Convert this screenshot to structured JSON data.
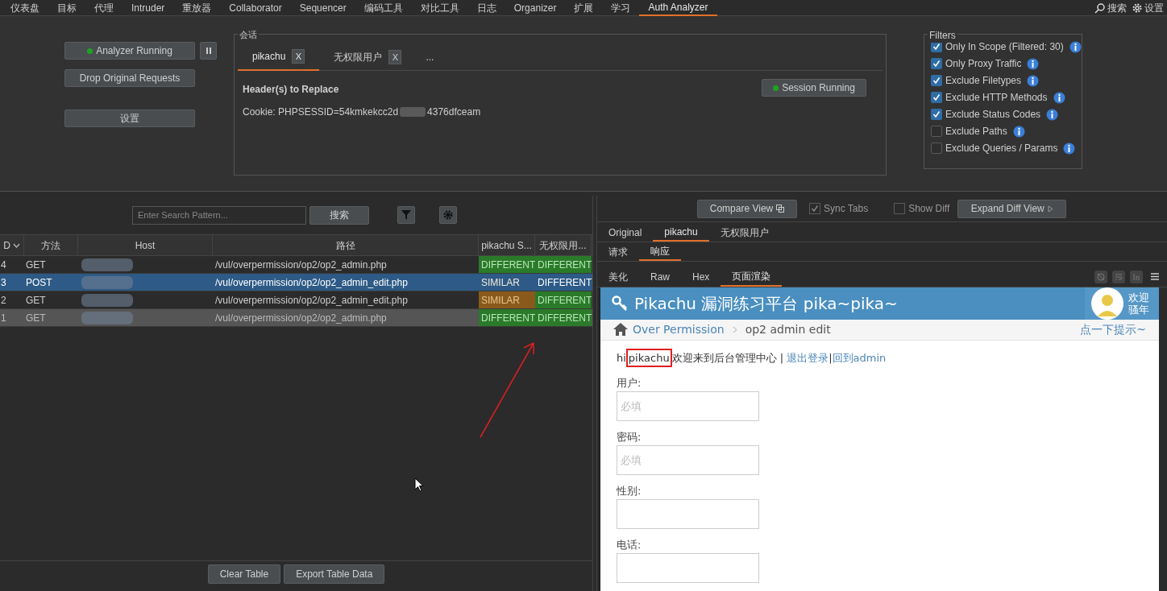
{
  "menu_tabs": [
    {
      "label": "仪表盘",
      "selected": false
    },
    {
      "label": "目标",
      "selected": false
    },
    {
      "label": "代理",
      "selected": false
    },
    {
      "label": "Intruder",
      "selected": false
    },
    {
      "label": "重放器",
      "selected": false
    },
    {
      "label": "Collaborator",
      "selected": false
    },
    {
      "label": "Sequencer",
      "selected": false
    },
    {
      "label": "编码工具",
      "selected": false
    },
    {
      "label": "对比工具",
      "selected": false
    },
    {
      "label": "日志",
      "selected": false
    },
    {
      "label": "Organizer",
      "selected": false
    },
    {
      "label": "扩展",
      "selected": false
    },
    {
      "label": "学习",
      "selected": false
    },
    {
      "label": "Auth Analyzer",
      "selected": true
    }
  ],
  "top_right": {
    "search": "搜索",
    "settings": "设置"
  },
  "analyzer": {
    "running_button": "Analyzer Running",
    "running": true,
    "drop_button": "Drop Original Requests",
    "settings_button": "设置"
  },
  "session": {
    "legend": "会话",
    "tabs": [
      {
        "label": "pikachu",
        "selected": true,
        "close": "X"
      },
      {
        "label": "无权限用户",
        "selected": false,
        "close": "X"
      }
    ],
    "more": "...",
    "header_title": "Header(s) to Replace",
    "cookie_start": "Cookie: PHPSESSID=54kmkekcc2d",
    "cookie_end": "4376dfceam",
    "session_button": "Session Running",
    "session_running": true
  },
  "filters": {
    "legend": "Filters",
    "items": [
      {
        "label": "Only In Scope (Filtered: 30)",
        "checked": true
      },
      {
        "label": "Only Proxy Traffic",
        "checked": true
      },
      {
        "label": "Exclude Filetypes",
        "checked": true
      },
      {
        "label": "Exclude HTTP Methods",
        "checked": true
      },
      {
        "label": "Exclude Status Codes",
        "checked": true
      },
      {
        "label": "Exclude Paths",
        "checked": false
      },
      {
        "label": "Exclude Queries / Params",
        "checked": false
      }
    ]
  },
  "table": {
    "search_placeholder": "Enter Search Pattern...",
    "search_button": "搜索",
    "columns": [
      "D",
      "方法",
      "Host",
      "路径",
      "pikachu S...",
      "无权限用..."
    ],
    "rows": [
      {
        "id": "4",
        "method": "GET",
        "path": "/vul/overpermission/op2/op2_admin.php",
        "selected": false,
        "highlighted": false,
        "results": [
          {
            "text": "DIFFERENT",
            "kind": "different"
          },
          {
            "text": "DIFFERENT",
            "kind": "different"
          }
        ]
      },
      {
        "id": "3",
        "method": "POST",
        "path": "/vul/overpermission/op2/op2_admin_edit.php",
        "selected": true,
        "highlighted": false,
        "results": [
          {
            "text": "SIMILAR",
            "kind": "similar"
          },
          {
            "text": "DIFFERENT",
            "kind": "different"
          }
        ]
      },
      {
        "id": "2",
        "method": "GET",
        "path": "/vul/overpermission/op2/op2_admin_edit.php",
        "selected": false,
        "highlighted": false,
        "results": [
          {
            "text": "SIMILAR",
            "kind": "similar"
          },
          {
            "text": "DIFFERENT",
            "kind": "different"
          }
        ]
      },
      {
        "id": "1",
        "method": "GET",
        "path": "/vul/overpermission/op2/op2_admin.php",
        "selected": false,
        "highlighted": true,
        "results": [
          {
            "text": "DIFFERENT",
            "kind": "different"
          },
          {
            "text": "DIFFERENT",
            "kind": "different"
          }
        ]
      }
    ],
    "footer_buttons": [
      "Clear Table",
      "Export Table Data"
    ]
  },
  "compare": {
    "compare_button": "Compare View",
    "sync_tabs": {
      "label": "Sync Tabs",
      "checked": true
    },
    "show_diff": {
      "label": "Show Diff",
      "checked": false
    },
    "expand_button": "Expand Diff View",
    "session_tabs": [
      {
        "label": "Original",
        "selected": false
      },
      {
        "label": "pikachu",
        "selected": true
      },
      {
        "label": "无权限用户",
        "selected": false
      }
    ],
    "message_tabs": [
      {
        "label": "请求",
        "selected": false
      },
      {
        "label": "响应",
        "selected": true
      }
    ],
    "view_tabs": [
      {
        "label": "美化",
        "selected": false
      },
      {
        "label": "Raw",
        "selected": false
      },
      {
        "label": "Hex",
        "selected": false
      },
      {
        "label": "页面渲染",
        "selected": true
      }
    ]
  },
  "web_page": {
    "title": "Pikachu 漏洞练习平台 pika~pika~",
    "welcome": [
      "欢迎",
      "骚年"
    ],
    "breadcrumb_link": "Over Permission",
    "breadcrumb_current": "op2 admin edit",
    "hint": "点一下提示~",
    "greeting": {
      "hi": "hi",
      "user": "pikachu",
      "text": "欢迎来到后台管理中心 |",
      "logout": "退出登录",
      "separator": "|",
      "back": "回到admin"
    },
    "fields": [
      {
        "label": "用户:",
        "placeholder": "必填"
      },
      {
        "label": "密码:",
        "placeholder": "必填"
      },
      {
        "label": "性别:"
      },
      {
        "label": "电话:"
      }
    ]
  }
}
